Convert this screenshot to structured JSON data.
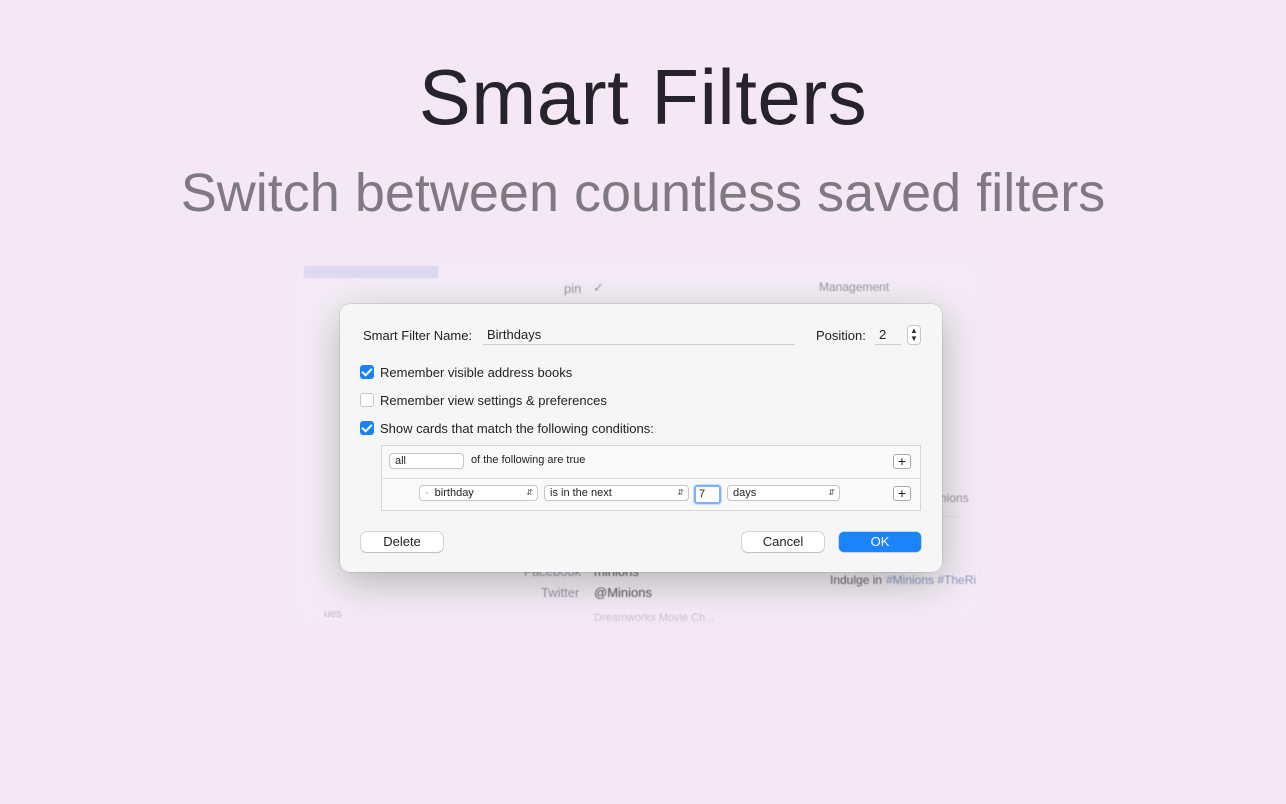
{
  "headline": "Smart Filters",
  "subline": "Switch between countless saved filters",
  "background_window": {
    "pin_label": "pin",
    "pin_check": "✓",
    "management": "Management",
    "facebook_label": "Facebook",
    "facebook_value": "minions",
    "twitter_label": "Twitter",
    "twitter_value": "@Minions",
    "right_partial": "nions",
    "indulge_text": "Indulge in",
    "indulge_tags": "#Minions #TheRi",
    "bottom_left": "ues",
    "bottom_mid": "Dreamworks Movie Ch..."
  },
  "dialog": {
    "name_label": "Smart Filter Name:",
    "name_value": "Birthdays",
    "position_label": "Position:",
    "position_value": "2",
    "options": [
      {
        "label": "Remember visible address books",
        "checked": true
      },
      {
        "label": "Remember view settings & preferences",
        "checked": false
      },
      {
        "label": "Show cards that match the following conditions:",
        "checked": true
      }
    ],
    "match_select": "all",
    "match_text": "of the following are true",
    "rule": {
      "field": "birthday",
      "operator": "is in the next",
      "number": "7",
      "unit": "days"
    },
    "delete_label": "Delete",
    "cancel_label": "Cancel",
    "ok_label": "OK"
  },
  "colors": {
    "accent": "#1b83fb",
    "background": "#f3e8f4"
  }
}
